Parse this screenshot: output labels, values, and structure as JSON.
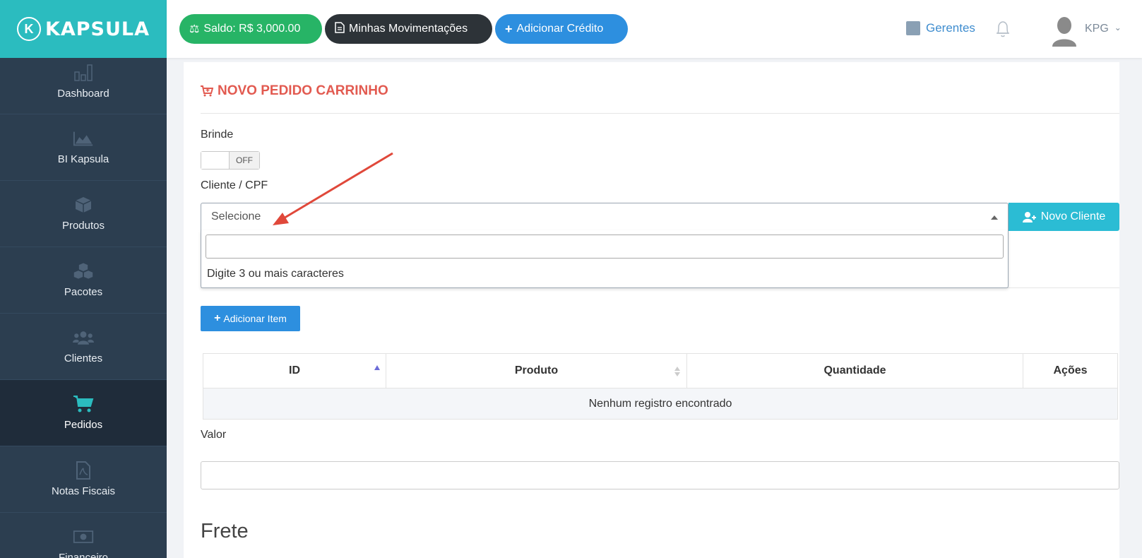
{
  "brand": {
    "name": "KAPSULA",
    "accent": "#2bbcbf"
  },
  "sidebar": {
    "items": [
      {
        "label": "Dashboard",
        "icon": "bar-chart-icon"
      },
      {
        "label": "BI Kapsula",
        "icon": "area-chart-icon"
      },
      {
        "label": "Produtos",
        "icon": "cube-icon"
      },
      {
        "label": "Pacotes",
        "icon": "cubes-icon"
      },
      {
        "label": "Clientes",
        "icon": "users-icon"
      },
      {
        "label": "Pedidos",
        "icon": "cart-icon",
        "active": true
      },
      {
        "label": "Notas Fiscais",
        "icon": "pdf-file-icon"
      },
      {
        "label": "Financeiro",
        "icon": "money-icon"
      }
    ]
  },
  "topbar": {
    "saldo": "Saldo: R$ 3,000.00",
    "movimentacoes": "Minhas Movimentações",
    "adicionar_credito": "Adicionar Crédito",
    "gerentes": "Gerentes",
    "user": "KPG"
  },
  "form": {
    "title": "NOVO PEDIDO CARRINHO",
    "brinde_label": "Brinde",
    "brinde_toggle": "OFF",
    "cliente_label": "Cliente / CPF",
    "cliente_placeholder": "Selecione",
    "dropdown_search_value": "",
    "dropdown_hint": "Digite 3 ou mais caracteres",
    "novo_cliente": "Novo Cliente",
    "adicionar_item": "Adicionar Item",
    "table": {
      "columns": [
        "ID",
        "Produto",
        "Quantidade",
        "Ações"
      ],
      "empty": "Nenhum registro encontrado"
    },
    "valor_label": "Valor",
    "valor_value": "",
    "frete_heading": "Frete"
  }
}
